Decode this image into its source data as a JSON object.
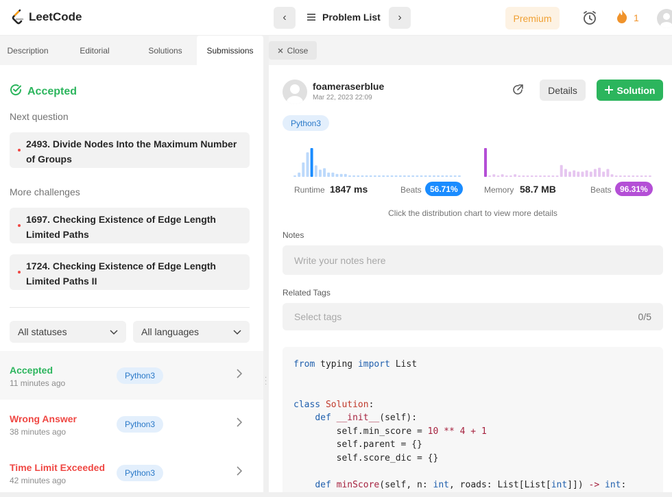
{
  "header": {
    "logo_text": "LeetCode",
    "problem_list_label": "Problem List",
    "premium_label": "Premium",
    "streak_count": "1"
  },
  "left": {
    "tabs": [
      {
        "label": "Description"
      },
      {
        "label": "Editorial"
      },
      {
        "label": "Solutions"
      },
      {
        "label": "Submissions"
      }
    ],
    "status": "Accepted",
    "next_question_label": "Next question",
    "next_question": "2493. Divide Nodes Into the Maximum Number of Groups",
    "more_challenges_label": "More challenges",
    "challenges": [
      "1697. Checking Existence of Edge Length Limited Paths",
      "1724. Checking Existence of Edge Length Limited Paths II"
    ],
    "filters": {
      "status": "All statuses",
      "language": "All languages"
    },
    "submissions": [
      {
        "status": "Accepted",
        "time": "11 minutes ago",
        "lang": "Python3",
        "color": "#2cb55d"
      },
      {
        "status": "Wrong Answer",
        "time": "38 minutes ago",
        "lang": "Python3",
        "color": "#ef4743"
      },
      {
        "status": "Time Limit Exceeded",
        "time": "42 minutes ago",
        "lang": "Python3",
        "color": "#ef4743"
      }
    ]
  },
  "right": {
    "close_label": "Close",
    "username": "foameraserblue",
    "date": "Mar 22, 2023 22:09",
    "details_label": "Details",
    "solution_label": "Solution",
    "language": "Python3",
    "runtime": {
      "label": "Runtime",
      "value": "1847 ms",
      "beats_label": "Beats",
      "beats": "56.71%",
      "color": "#1a8cff"
    },
    "memory": {
      "label": "Memory",
      "value": "58.7 MB",
      "beats_label": "Beats",
      "beats": "96.31%",
      "color": "#b44fd6"
    },
    "hint": "Click the distribution chart to view more details",
    "notes_label": "Notes",
    "notes_placeholder": "Write your notes here",
    "tags_label": "Related Tags",
    "tags_placeholder": "Select tags",
    "tags_count": "0/5"
  },
  "code": {
    "lines": [
      "from typing import List",
      "",
      "",
      "class Solution:",
      "    def __init__(self):",
      "        self.min_score = 10 ** 4 + 1",
      "        self.parent = {}",
      "        self.score_dic = {}",
      "",
      "    def minScore(self, n: int, roads: List[List[int]]) -> int:"
    ]
  },
  "chart_data": [
    {
      "type": "bar",
      "name": "runtime-distribution",
      "values": [
        1,
        3,
        10,
        17,
        20,
        8,
        5,
        6,
        3,
        3,
        2,
        2,
        2,
        1,
        1,
        1,
        1,
        1,
        1,
        1,
        1,
        1,
        1,
        1,
        1,
        1,
        1,
        1,
        1,
        1,
        1,
        1,
        1,
        1,
        1,
        1,
        1,
        1,
        1,
        1
      ],
      "highlight_index": 4
    },
    {
      "type": "bar",
      "name": "memory-distribution",
      "values": [
        22,
        1,
        2,
        1,
        2,
        1,
        1,
        2,
        1,
        1,
        1,
        1,
        1,
        1,
        1,
        1,
        1,
        1,
        9,
        6,
        4,
        5,
        4,
        4,
        5,
        4,
        6,
        7,
        4,
        6,
        2,
        1,
        1,
        1,
        1,
        1,
        1,
        1,
        1,
        1
      ],
      "highlight_index": 0
    }
  ]
}
